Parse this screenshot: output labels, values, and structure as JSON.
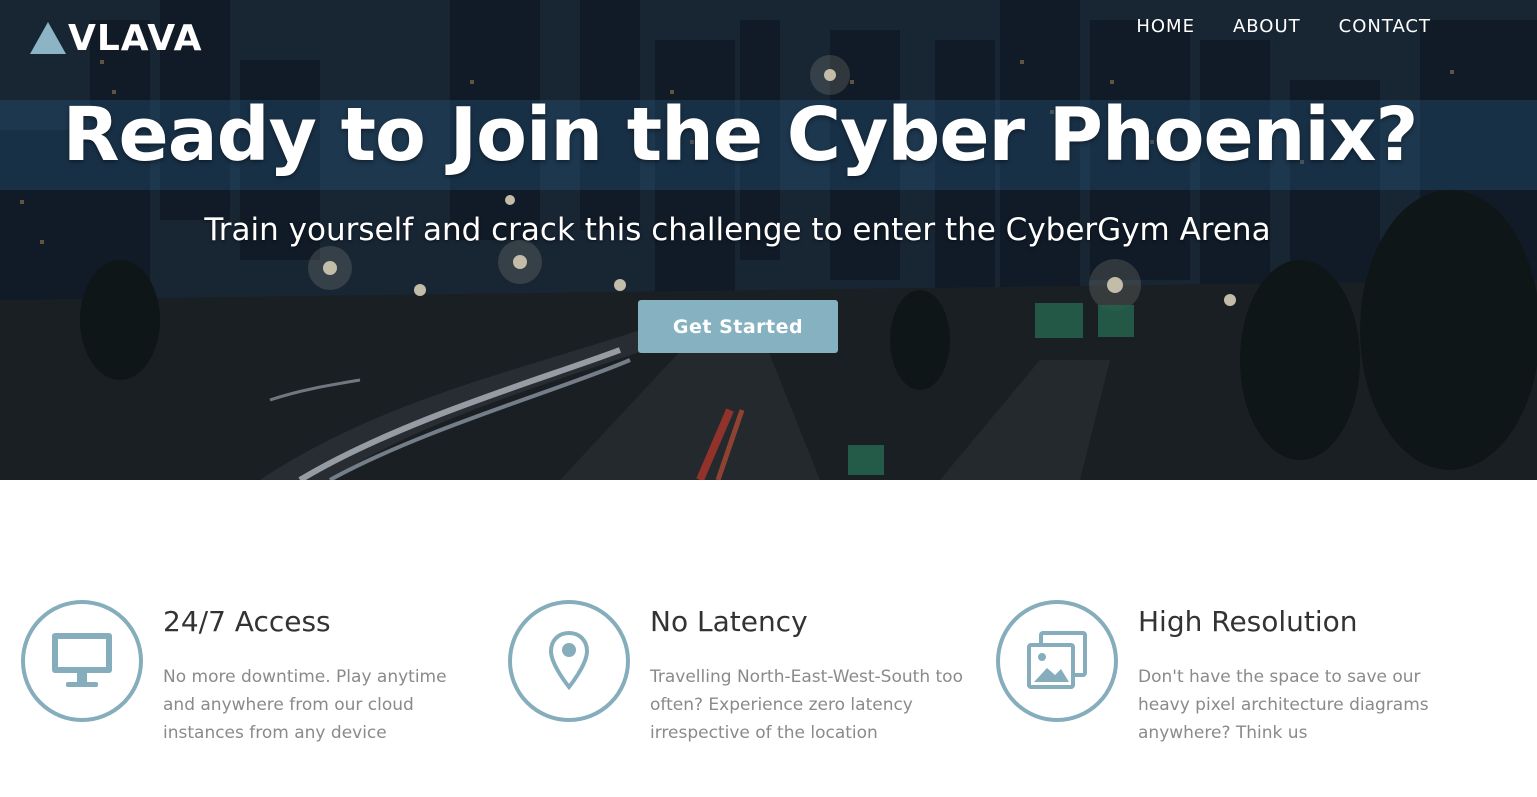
{
  "brand": {
    "name": "VLAVA",
    "accent": "#86b1c0"
  },
  "nav": {
    "items": [
      "HOME",
      "ABOUT",
      "CONTACT"
    ]
  },
  "hero": {
    "headline": "Ready to Join the Cyber Phoenix?",
    "subline": "Train yourself and crack this challenge to enter the CyberGym Arena",
    "cta_label": "Get Started",
    "background": "night-city-highway-photo"
  },
  "features": [
    {
      "icon": "monitor-icon",
      "title": "24/7 Access",
      "description": "No more downtime. Play anytime and anywhere from our cloud instances from any device"
    },
    {
      "icon": "location-pin-icon",
      "title": "No Latency",
      "description": "Travelling North-East-West-South too often? Experience zero latency irrespective of the location"
    },
    {
      "icon": "images-icon",
      "title": "High Resolution",
      "description": "Don't have the space to save our heavy pixel architecture diagrams anywhere? Think us"
    }
  ]
}
